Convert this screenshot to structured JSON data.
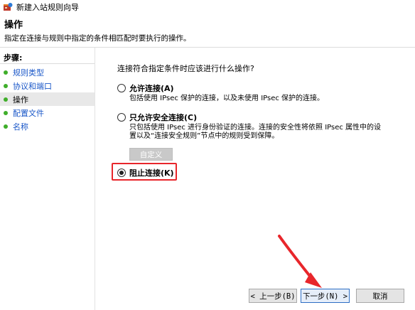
{
  "window": {
    "title": "新建入站规则向导"
  },
  "header": {
    "title": "操作",
    "description": "指定在连接与规则中指定的条件相匹配时要执行的操作。"
  },
  "sidebar": {
    "title": "步骤:",
    "items": [
      {
        "label": "规则类型"
      },
      {
        "label": "协议和端口"
      },
      {
        "label": "操作"
      },
      {
        "label": "配置文件"
      },
      {
        "label": "名称"
      }
    ]
  },
  "main": {
    "question": "连接符合指定条件时应该进行什么操作?",
    "options": [
      {
        "label": "允许连接(A)",
        "description": "包括使用 IPsec 保护的连接，以及未使用 IPsec 保护的连接。"
      },
      {
        "label": "只允许安全连接(C)",
        "description_line1": "只包括使用 IPsec 进行身份验证的连接。连接的安全性将依照 IPsec 属性中的设",
        "description_line2": "置以及“连接安全规则”节点中的规则受到保障。"
      },
      {
        "label": "阻止连接(K)"
      }
    ],
    "customize_label": "自定义",
    "selected_option": "block"
  },
  "buttons": {
    "prev": "< 上一步(B)",
    "next": "下一步(N) >",
    "cancel": "取消"
  },
  "colors": {
    "accent": "#1a57c8",
    "step_dot": "#3fae2a",
    "annotation": "#e8262b"
  }
}
